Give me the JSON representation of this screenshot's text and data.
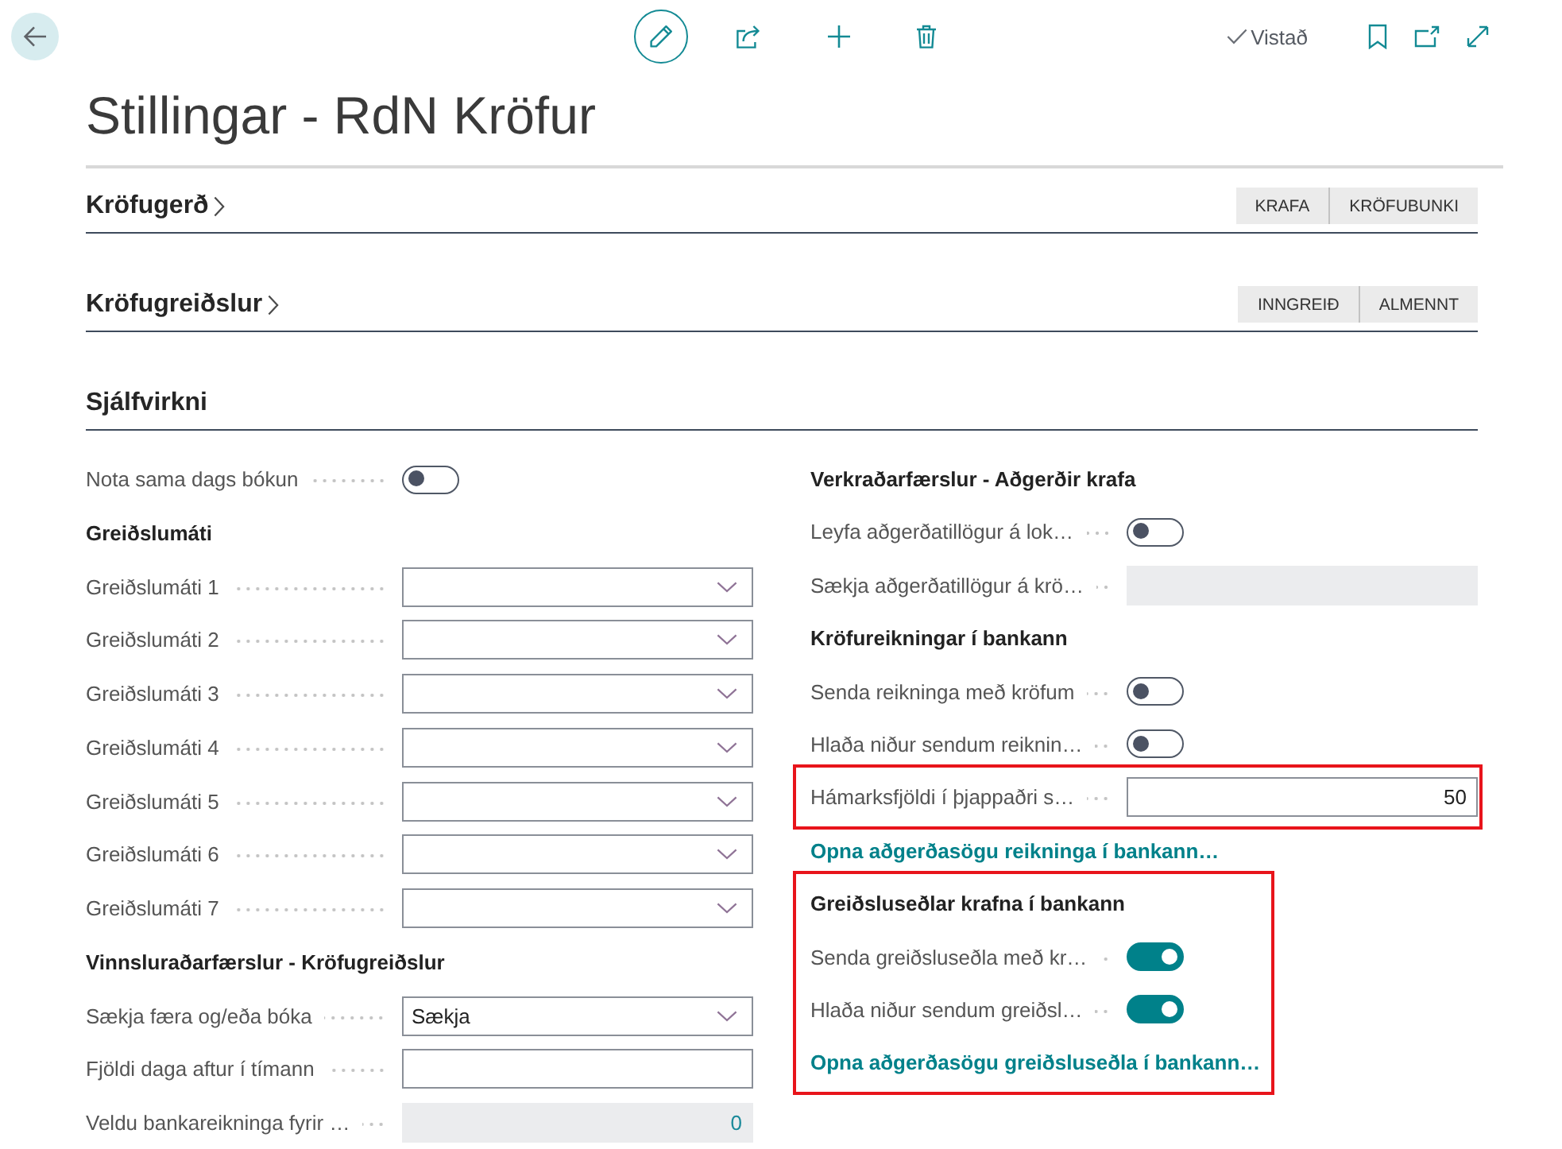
{
  "toolbar": {
    "editing": true,
    "status": "Vistað"
  },
  "title": "Stillingar - RdN Kröfur",
  "sections": [
    {
      "title": "Kröfugerð",
      "expanded": false,
      "actions": [
        "KRAFA",
        "KRÖFUBUNKI"
      ]
    },
    {
      "title": "Kröfugreiðslur",
      "expanded": false,
      "actions": [
        "INNGREIÐ",
        "ALMENNT"
      ]
    },
    {
      "title": "Sjálfvirkni",
      "expanded": true,
      "columns": [
        {
          "groups": [
            {
              "highlighted": false,
              "rows": [
                {
                  "kind": "toggle",
                  "label": "Nota sama dags bókun",
                  "on": false
                }
              ]
            },
            {
              "heading": "Greiðslumáti",
              "highlighted": false,
              "rows": [
                {
                  "kind": "dropdown",
                  "label": "Greiðslumáti 1"
                },
                {
                  "kind": "dropdown",
                  "label": "Greiðslumáti 2"
                },
                {
                  "kind": "dropdown",
                  "label": "Greiðslumáti 3"
                },
                {
                  "kind": "dropdown",
                  "label": "Greiðslumáti 4"
                },
                {
                  "kind": "dropdown",
                  "label": "Greiðslumáti 5"
                },
                {
                  "kind": "dropdown",
                  "label": "Greiðslumáti 6"
                },
                {
                  "kind": "dropdown",
                  "label": "Greiðslumáti 7"
                }
              ]
            },
            {
              "heading": "Vinnsluraðarfærslur - Kröfugreiðslur",
              "highlighted": false,
              "rows": [
                {
                  "kind": "dropdown",
                  "label": "Sækja færa og/eða bóka",
                  "value": "Sækja"
                },
                {
                  "kind": "text",
                  "label": "Fjöldi daga aftur í tímann"
                },
                {
                  "kind": "readonly",
                  "label": "Veldu bankareikninga fyrir …",
                  "value": "0"
                }
              ]
            }
          ]
        },
        {
          "groups": [
            {
              "heading": "Verkraðarfærslur - Aðgerðir krafa",
              "highlighted": false,
              "rows": [
                {
                  "kind": "toggle",
                  "label": "Leyfa aðgerðatillögur á lok…",
                  "on": false
                },
                {
                  "kind": "readonly",
                  "label": "Sækja aðgerðatillögur á krö…"
                }
              ]
            },
            {
              "heading": "Kröfureikningar í bankann",
              "highlighted": false,
              "rows": [
                {
                  "kind": "toggle",
                  "label": "Senda reikninga með kröfum",
                  "on": false
                },
                {
                  "kind": "toggle",
                  "label": "Hlaða niður sendum reiknin…",
                  "on": false
                }
              ]
            },
            {
              "highlighted": true,
              "rows": [
                {
                  "kind": "text",
                  "label": "Hámarksfjöldi í þjappaðri s…",
                  "value": "50"
                }
              ]
            },
            {
              "highlighted": false,
              "rows": [
                {
                  "kind": "link",
                  "label": "Opna aðgerðasögu reikninga í bankann…"
                }
              ]
            },
            {
              "heading": "Greiðsluseðlar krafna í bankann",
              "highlighted": true,
              "rows": [
                {
                  "kind": "toggle",
                  "label": "Senda greiðsluseðla með kr…",
                  "on": true
                },
                {
                  "kind": "toggle",
                  "label": "Hlaða niður sendum greiðsl…",
                  "on": true
                },
                {
                  "kind": "link",
                  "label": "Opna aðgerðasögu greiðsluseðla í bankann…"
                }
              ]
            }
          ]
        }
      ]
    }
  ]
}
